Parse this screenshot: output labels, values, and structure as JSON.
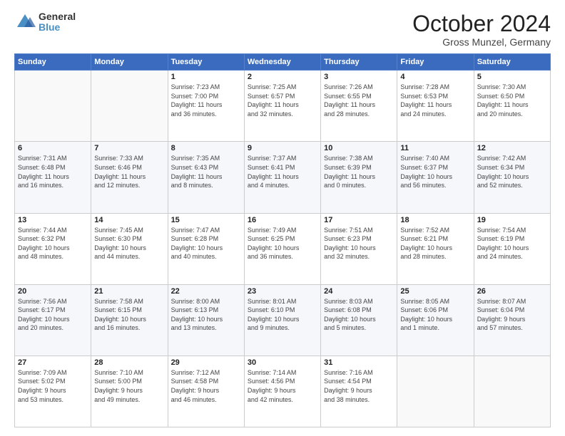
{
  "header": {
    "logo_general": "General",
    "logo_blue": "Blue",
    "title": "October 2024",
    "location": "Gross Munzel, Germany"
  },
  "weekdays": [
    "Sunday",
    "Monday",
    "Tuesday",
    "Wednesday",
    "Thursday",
    "Friday",
    "Saturday"
  ],
  "weeks": [
    [
      {
        "day": "",
        "info": ""
      },
      {
        "day": "",
        "info": ""
      },
      {
        "day": "1",
        "info": "Sunrise: 7:23 AM\nSunset: 7:00 PM\nDaylight: 11 hours\nand 36 minutes."
      },
      {
        "day": "2",
        "info": "Sunrise: 7:25 AM\nSunset: 6:57 PM\nDaylight: 11 hours\nand 32 minutes."
      },
      {
        "day": "3",
        "info": "Sunrise: 7:26 AM\nSunset: 6:55 PM\nDaylight: 11 hours\nand 28 minutes."
      },
      {
        "day": "4",
        "info": "Sunrise: 7:28 AM\nSunset: 6:53 PM\nDaylight: 11 hours\nand 24 minutes."
      },
      {
        "day": "5",
        "info": "Sunrise: 7:30 AM\nSunset: 6:50 PM\nDaylight: 11 hours\nand 20 minutes."
      }
    ],
    [
      {
        "day": "6",
        "info": "Sunrise: 7:31 AM\nSunset: 6:48 PM\nDaylight: 11 hours\nand 16 minutes."
      },
      {
        "day": "7",
        "info": "Sunrise: 7:33 AM\nSunset: 6:46 PM\nDaylight: 11 hours\nand 12 minutes."
      },
      {
        "day": "8",
        "info": "Sunrise: 7:35 AM\nSunset: 6:43 PM\nDaylight: 11 hours\nand 8 minutes."
      },
      {
        "day": "9",
        "info": "Sunrise: 7:37 AM\nSunset: 6:41 PM\nDaylight: 11 hours\nand 4 minutes."
      },
      {
        "day": "10",
        "info": "Sunrise: 7:38 AM\nSunset: 6:39 PM\nDaylight: 11 hours\nand 0 minutes."
      },
      {
        "day": "11",
        "info": "Sunrise: 7:40 AM\nSunset: 6:37 PM\nDaylight: 10 hours\nand 56 minutes."
      },
      {
        "day": "12",
        "info": "Sunrise: 7:42 AM\nSunset: 6:34 PM\nDaylight: 10 hours\nand 52 minutes."
      }
    ],
    [
      {
        "day": "13",
        "info": "Sunrise: 7:44 AM\nSunset: 6:32 PM\nDaylight: 10 hours\nand 48 minutes."
      },
      {
        "day": "14",
        "info": "Sunrise: 7:45 AM\nSunset: 6:30 PM\nDaylight: 10 hours\nand 44 minutes."
      },
      {
        "day": "15",
        "info": "Sunrise: 7:47 AM\nSunset: 6:28 PM\nDaylight: 10 hours\nand 40 minutes."
      },
      {
        "day": "16",
        "info": "Sunrise: 7:49 AM\nSunset: 6:25 PM\nDaylight: 10 hours\nand 36 minutes."
      },
      {
        "day": "17",
        "info": "Sunrise: 7:51 AM\nSunset: 6:23 PM\nDaylight: 10 hours\nand 32 minutes."
      },
      {
        "day": "18",
        "info": "Sunrise: 7:52 AM\nSunset: 6:21 PM\nDaylight: 10 hours\nand 28 minutes."
      },
      {
        "day": "19",
        "info": "Sunrise: 7:54 AM\nSunset: 6:19 PM\nDaylight: 10 hours\nand 24 minutes."
      }
    ],
    [
      {
        "day": "20",
        "info": "Sunrise: 7:56 AM\nSunset: 6:17 PM\nDaylight: 10 hours\nand 20 minutes."
      },
      {
        "day": "21",
        "info": "Sunrise: 7:58 AM\nSunset: 6:15 PM\nDaylight: 10 hours\nand 16 minutes."
      },
      {
        "day": "22",
        "info": "Sunrise: 8:00 AM\nSunset: 6:13 PM\nDaylight: 10 hours\nand 13 minutes."
      },
      {
        "day": "23",
        "info": "Sunrise: 8:01 AM\nSunset: 6:10 PM\nDaylight: 10 hours\nand 9 minutes."
      },
      {
        "day": "24",
        "info": "Sunrise: 8:03 AM\nSunset: 6:08 PM\nDaylight: 10 hours\nand 5 minutes."
      },
      {
        "day": "25",
        "info": "Sunrise: 8:05 AM\nSunset: 6:06 PM\nDaylight: 10 hours\nand 1 minute."
      },
      {
        "day": "26",
        "info": "Sunrise: 8:07 AM\nSunset: 6:04 PM\nDaylight: 9 hours\nand 57 minutes."
      }
    ],
    [
      {
        "day": "27",
        "info": "Sunrise: 7:09 AM\nSunset: 5:02 PM\nDaylight: 9 hours\nand 53 minutes."
      },
      {
        "day": "28",
        "info": "Sunrise: 7:10 AM\nSunset: 5:00 PM\nDaylight: 9 hours\nand 49 minutes."
      },
      {
        "day": "29",
        "info": "Sunrise: 7:12 AM\nSunset: 4:58 PM\nDaylight: 9 hours\nand 46 minutes."
      },
      {
        "day": "30",
        "info": "Sunrise: 7:14 AM\nSunset: 4:56 PM\nDaylight: 9 hours\nand 42 minutes."
      },
      {
        "day": "31",
        "info": "Sunrise: 7:16 AM\nSunset: 4:54 PM\nDaylight: 9 hours\nand 38 minutes."
      },
      {
        "day": "",
        "info": ""
      },
      {
        "day": "",
        "info": ""
      }
    ]
  ]
}
